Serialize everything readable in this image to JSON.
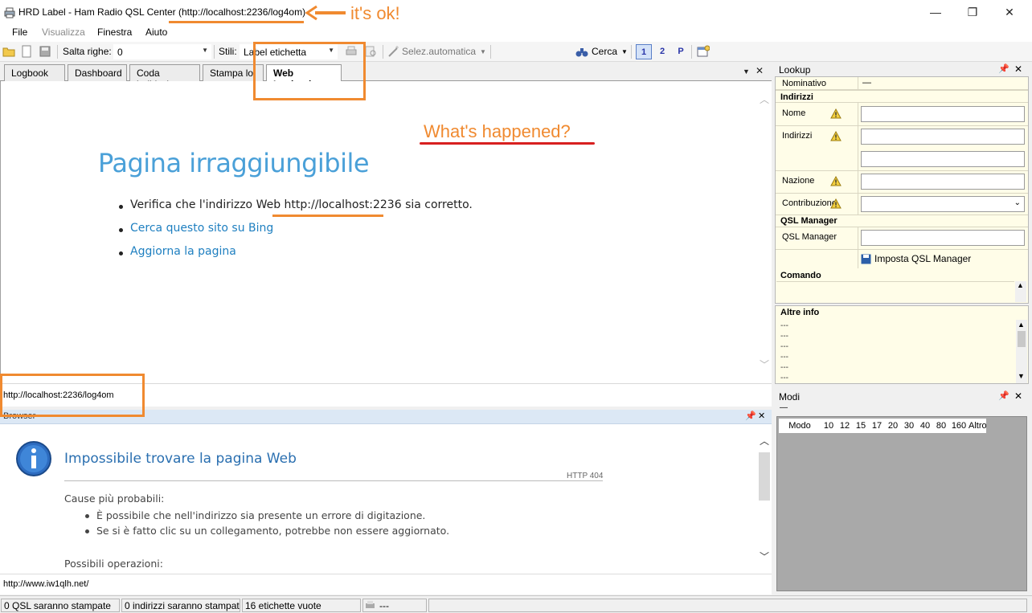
{
  "window": {
    "title": "HRD Label - Ham Radio QSL Center (http://localhost:2236/log4om)",
    "controls": {
      "minimize": "—",
      "maximize": "❐",
      "close": "✕"
    }
  },
  "menu": {
    "file": "File",
    "view": "Visualizza",
    "window": "Finestra",
    "help": "Aiuto"
  },
  "toolbar": {
    "skip_rows_label": "Salta righe:",
    "skip_rows_value": "0",
    "styles_label": "Stili:",
    "styles_value": "Label etichetta",
    "autoselect_label": "Selez.automatica",
    "search_label": "Cerca",
    "page_buttons": [
      "1",
      "2",
      "P"
    ]
  },
  "tabs": [
    "Logbook",
    "Dashboard",
    "Coda indirizzi",
    "Stampa lo",
    "Web Logbook"
  ],
  "active_tab": "Web Logbook",
  "web_page": {
    "title": "Pagina irraggiungibile",
    "bullet1_prefix": "Verifica che l'indirizzo Web ",
    "bullet1_url": "http://localhost:2236",
    "bullet1_suffix": " sia corretto.",
    "bullet2": "Cerca questo sito su Bing",
    "bullet3": "Aggiorna la pagina"
  },
  "address_bar": "http://localhost:2236/log4om",
  "browser_pane": {
    "header": "Browser",
    "title": "Impossibile trovare la pagina Web",
    "code": "HTTP 404",
    "causes_heading": "Cause più probabili:",
    "causes": [
      "È possibile che nell'indirizzo sia presente un errore di digitazione.",
      "Se si è fatto clic su un collegamento, potrebbe non essere aggiornato."
    ],
    "ops_heading": "Possibili operazioni:",
    "address": "http://www.iw1qlh.net/"
  },
  "lookup": {
    "header": "Lookup",
    "callsign_label": "Nominativo",
    "callsign_value": "—",
    "addresses_section": "Indirizzi",
    "name_label": "Nome",
    "address_label": "Indirizzi",
    "country_label": "Nazione",
    "contribution_label": "Contribuzione",
    "qsl_section": "QSL Manager",
    "qsl_label": "QSL Manager",
    "qsl_button": "Imposta QSL Manager",
    "command_section": "Comando"
  },
  "altre_info": {
    "header": "Altre info",
    "lines": [
      "---",
      "---",
      "---",
      "---",
      "---",
      "---"
    ]
  },
  "modi": {
    "header": "Modi",
    "dash": "—",
    "columns": [
      "Modo",
      "10",
      "12",
      "15",
      "17",
      "20",
      "30",
      "40",
      "80",
      "160",
      "Altro"
    ]
  },
  "status": {
    "qsl": "0 QSL saranno stampate",
    "addresses": "0 indirizzi saranno stampati",
    "labels": "16 etichette vuote",
    "extra": "---"
  },
  "annotations": {
    "ok": "it's ok!",
    "question": "What's happened?",
    "color": "#f08a30",
    "underline_color": "#d82020"
  }
}
